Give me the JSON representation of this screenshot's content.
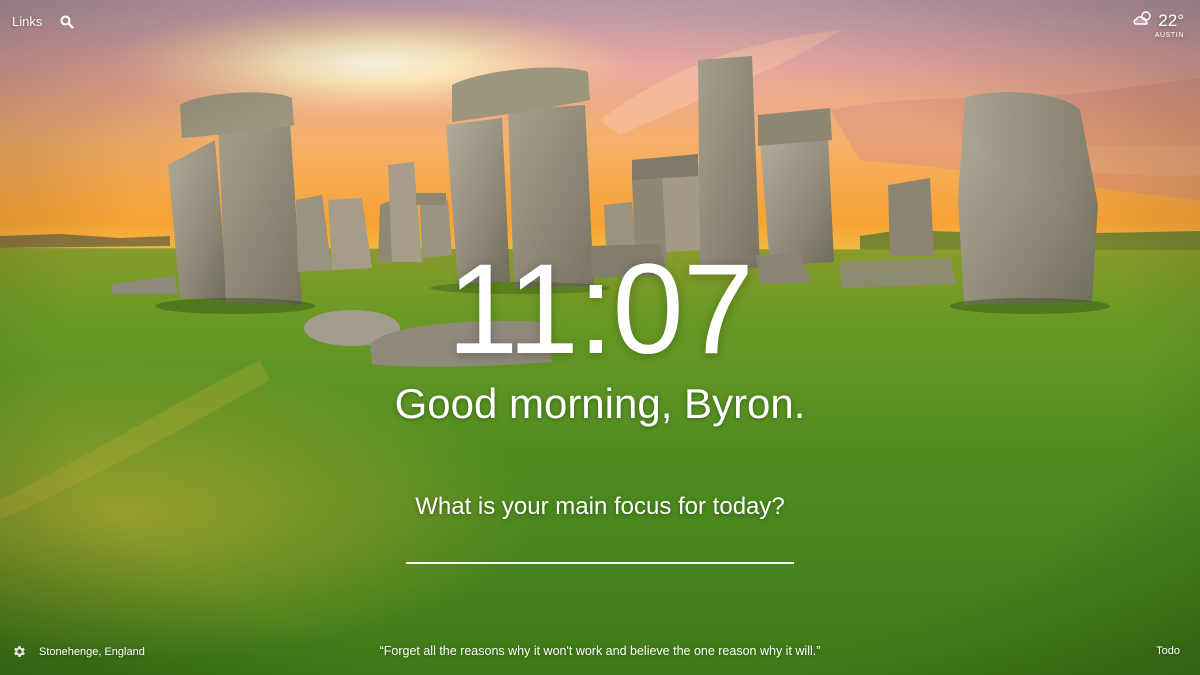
{
  "top_left": {
    "links_label": "Links",
    "search_icon": "search-icon"
  },
  "weather": {
    "icon": "cloud-sun-icon",
    "temperature": "22°",
    "location": "AUSTIN"
  },
  "clock": {
    "time": "11:07"
  },
  "greeting": {
    "text": "Good morning, Byron."
  },
  "focus": {
    "prompt": "What is your main focus for today?",
    "value": "",
    "placeholder": ""
  },
  "footer": {
    "settings_icon": "gear-icon",
    "photo_location": "Stonehenge, England",
    "quote": "“Forget all the reasons why it won't work and believe the one reason why it will.”",
    "todo_label": "Todo"
  },
  "colors": {
    "text": "#ffffff",
    "sky_top": "#d99aa0",
    "sky_horizon": "#f6a23a",
    "grass": "#4f8f22"
  }
}
